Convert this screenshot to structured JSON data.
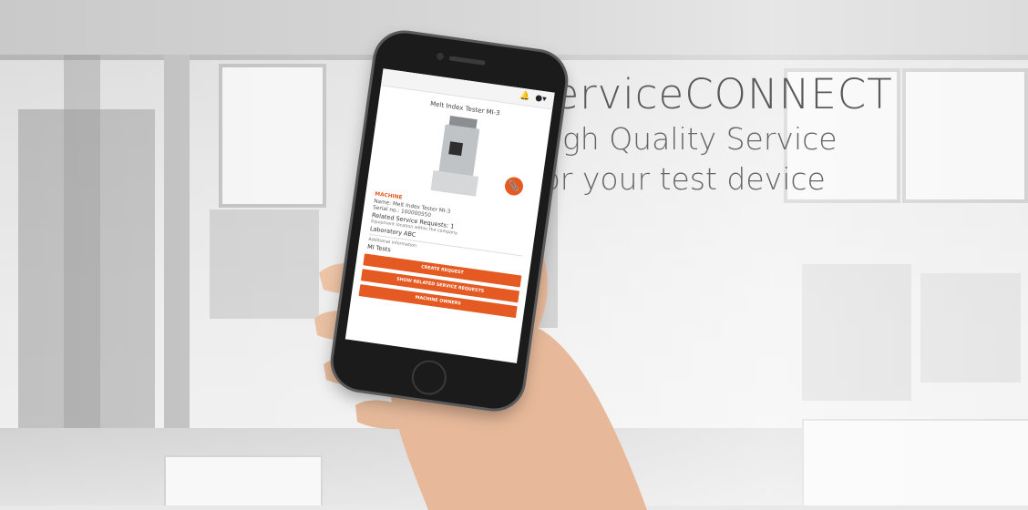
{
  "hero": {
    "title": "serviceCONNECT",
    "subtitle_line1": "High Quality Service",
    "subtitle_line2": "for your test device"
  },
  "app": {
    "topbar_icons": [
      "bell-icon",
      "account-icon"
    ],
    "product_title": "Melt Index Tester MI-3",
    "section_label": "MACHINE",
    "name_line": "Name: Melt Index Tester MI-3",
    "serial_line": "Serial no.: 100000550",
    "related_requests": "Related Service Requests: 1",
    "location_caption": "Equipment location within the company",
    "location_value": "Laboratory ABC",
    "additional_caption": "Additional information",
    "additional_value": "MI Tests",
    "buttons": {
      "create_request": "CREATE REQUEST",
      "show_related": "SHOW RELATED SERVICE REQUESTS",
      "machine_owners": "MACHINE OWNERS"
    }
  },
  "colors": {
    "accent": "#e45a22",
    "hero_text": "#5a5a5a"
  }
}
